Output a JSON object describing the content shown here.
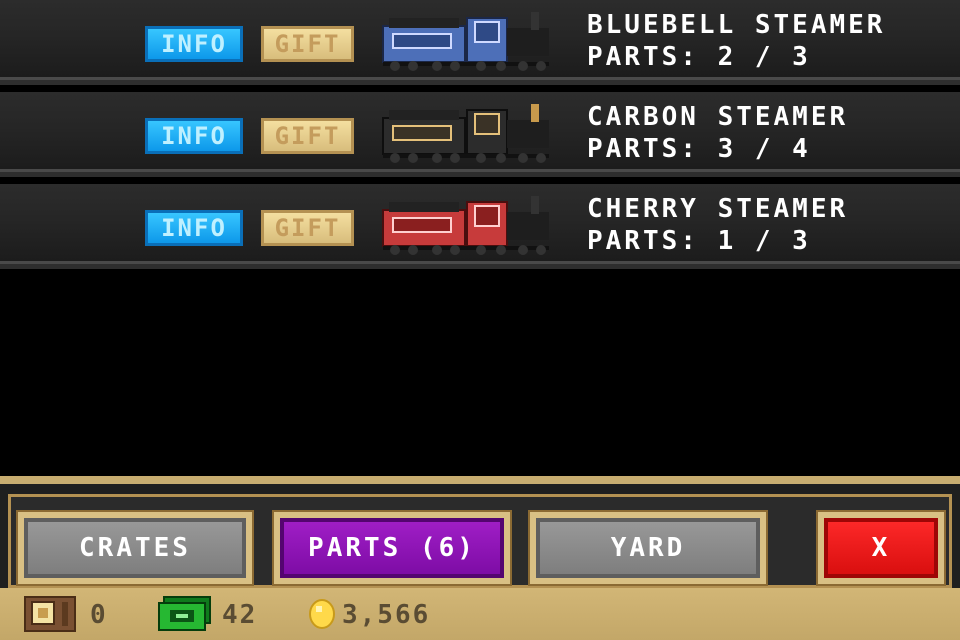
{
  "trains": [
    {
      "name": "BLUEBELL STEAMER",
      "parts": "PARTS: 2 / 3",
      "info_label": "INFO",
      "gift_label": "GIFT",
      "colors": {
        "body": "#4d6fb8",
        "trim": "#2f4a86",
        "accent": "#cfd9ff"
      }
    },
    {
      "name": "CARBON STEAMER",
      "parts": "PARTS: 3 / 4",
      "info_label": "INFO",
      "gift_label": "GIFT",
      "colors": {
        "body": "#2c2c2c",
        "trim": "#c89a4c",
        "accent": "#e4c07a"
      }
    },
    {
      "name": "CHERRY STEAMER",
      "parts": "PARTS: 1 / 3",
      "info_label": "INFO",
      "gift_label": "GIFT",
      "colors": {
        "body": "#c73b3b",
        "trim": "#8a1f1f",
        "accent": "#ffd0d0"
      }
    }
  ],
  "nav": {
    "crates_label": "CRATES",
    "parts_label": "PARTS (6)",
    "yard_label": "YARD",
    "close_label": "X"
  },
  "status": {
    "crates_count": "0",
    "cash": "42",
    "coins": "3,566"
  }
}
